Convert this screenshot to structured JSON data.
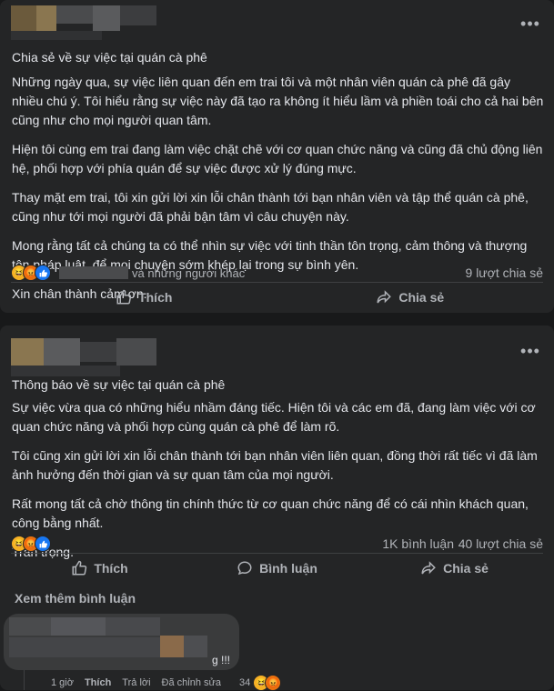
{
  "post1": {
    "title": "Chia sẻ về sự việc tại quán cà phê",
    "paragraphs": [
      "Những ngày qua, sự việc liên quan đến em trai tôi và một nhân viên quán cà phê đã gây nhiều chú ý. Tôi hiểu rằng sự việc này đã tạo ra không ít hiểu lầm và phiền toái cho cả hai bên cũng như cho mọi người quan tâm.",
      "Hiện tôi cùng em trai đang làm việc chặt chẽ với cơ quan chức năng và cũng đã chủ động liên hệ, phối hợp với phía quán để sự việc được xử lý đúng mực.",
      "Thay mặt em trai, tôi xin gửi lời xin lỗi chân thành tới bạn nhân viên và tập thể quán cà phê, cũng như tới mọi người đã phải bận tâm vì câu chuyện này.",
      "Mong rằng tất cả chúng ta có thể nhìn sự việc với tinh thần tôn trọng, cảm thông và thượng tôn pháp luật, để mọi chuyện sớm khép lại trong sự bình yên.",
      "Xin chân thành cảm ơn."
    ],
    "reactions_text": "và những người khác",
    "shares": "9 lượt chia sẻ",
    "like_label": "Thích",
    "share_label": "Chia sẻ"
  },
  "post2": {
    "title": "Thông báo về sự việc tại quán cà phê",
    "paragraphs": [
      "Sự việc vừa qua có những hiểu nhầm đáng tiếc. Hiện tôi và các em đã, đang làm việc với cơ quan chức năng và phối hợp cùng quán cà phê để làm rõ.",
      "Tôi cũng xin gửi lời xin lỗi chân thành tới bạn nhân viên liên quan, đồng thời rất tiếc vì đã làm ảnh hưởng đến thời gian và sự quan tâm của mọi người.",
      "Rất mong tất cả chờ thông tin chính thức từ cơ quan chức năng để có cái nhìn khách quan, công bằng nhất.",
      "Trân trọng."
    ],
    "comments_count": "1K bình luận",
    "shares": "40 lượt chia sẻ",
    "like_label": "Thích",
    "comment_label": "Bình luận",
    "share_label": "Chia sẻ"
  },
  "comments": {
    "see_more": "Xem thêm bình luận",
    "first": {
      "text_tail": "g !!!",
      "time": "1 giờ",
      "like": "Thích",
      "reply": "Trả lời",
      "edited": "Đã chỉnh sửa",
      "reaction_count": "34"
    }
  },
  "icons": {
    "more": "more-horizontal-icon",
    "like": "thumbs-up-icon",
    "share": "share-arrow-icon",
    "comment": "speech-bubble-icon"
  },
  "colors": {
    "background": "#18191a",
    "card": "#242526",
    "text": "#e4e6eb",
    "muted": "#b0b3b8",
    "like_blue": "#1877f2"
  }
}
